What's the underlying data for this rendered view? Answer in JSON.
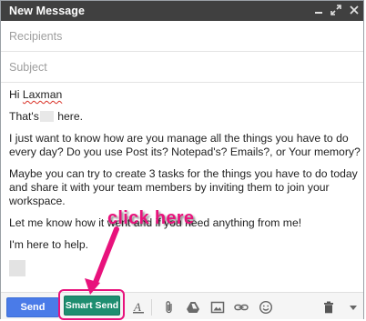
{
  "window": {
    "title": "New Message"
  },
  "fields": {
    "recipients_placeholder": "Recipients",
    "subject_placeholder": "Subject"
  },
  "body": {
    "greeting_prefix": "Hi ",
    "greeting_name": "Laxman",
    "thats_prefix": "That's",
    "thats_suffix": " here.",
    "para1": "I just want to know how are you manage all the things you have to do every day? Do you use Post its? Notepad's? Emails?, or Your memory?",
    "para2": "Maybe you can try to create 3 tasks for the things you have to do today and share it with your team members by inviting them to join your workspace.",
    "para3": "Let me know how it went and if you need anything from me!",
    "para4": "I'm here to help."
  },
  "annotation": {
    "callout_text": "click here",
    "color": "#e8127c"
  },
  "toolbar": {
    "send_label": "Send",
    "smart_send_label": "Smart Send",
    "icons": [
      "format-text-icon",
      "attach-icon",
      "drive-icon",
      "insert-photo-icon",
      "insert-link-icon",
      "emoji-icon",
      "trash-icon",
      "more-options-icon"
    ]
  },
  "colors": {
    "titlebar": "#404040",
    "send_button": "#4a7be8",
    "smart_send_button": "#1e8e70"
  }
}
